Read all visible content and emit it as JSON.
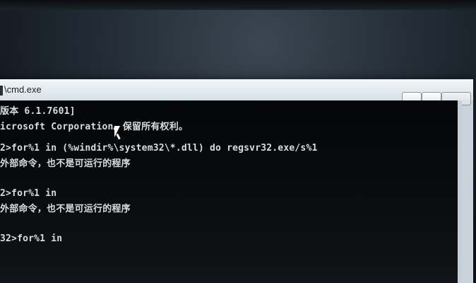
{
  "window": {
    "title": "\\cmd.exe",
    "controls": [
      "",
      "",
      ""
    ]
  },
  "console": {
    "lines": [
      "版本 6.1.7601]",
      "icrosoft Corporation。保留所有权利。",
      "",
      "2>for%1 in (%windir%\\system32\\*.dll) do regsvr32.exe/s%1",
      "外部命令，也不是可运行的程序",
      "",
      "",
      "2>for%1 in",
      "外部命令，也不是可运行的程序",
      "",
      "",
      "32>for%1 in"
    ]
  },
  "colors": {
    "console_bg": "#050607",
    "console_text": "#d9dde0",
    "titlebar": "#e6edf3"
  }
}
